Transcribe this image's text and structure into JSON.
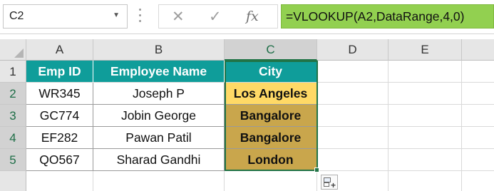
{
  "formula_bar": {
    "name_box_value": "C2",
    "cancel_icon": "close-icon",
    "enter_icon": "check-icon",
    "function_label": "fx",
    "formula": "=VLOOKUP(A2,DataRange,4,0)",
    "formula_bg": "#92d050"
  },
  "columns": [
    "A",
    "B",
    "C",
    "D",
    "E"
  ],
  "rows": [
    "1",
    "2",
    "3",
    "4",
    "5"
  ],
  "table": {
    "headers": [
      "Emp ID",
      "Employee Name",
      "City"
    ],
    "header_bg": "#0f9d9a",
    "records": [
      {
        "emp_id": "WR345",
        "name": "Joseph P",
        "city": "Los Angeles"
      },
      {
        "emp_id": "GC774",
        "name": "Jobin George",
        "city": "Bangalore"
      },
      {
        "emp_id": "EF282",
        "name": "Pawan Patil",
        "city": "Bangalore"
      },
      {
        "emp_id": "QO567",
        "name": "Sharad Gandhi",
        "city": "London"
      }
    ]
  },
  "selection": {
    "active_cell": "C2",
    "range": "C2:C5",
    "accent": "#217346"
  },
  "quick_analysis_icon": "quick-analysis-icon"
}
